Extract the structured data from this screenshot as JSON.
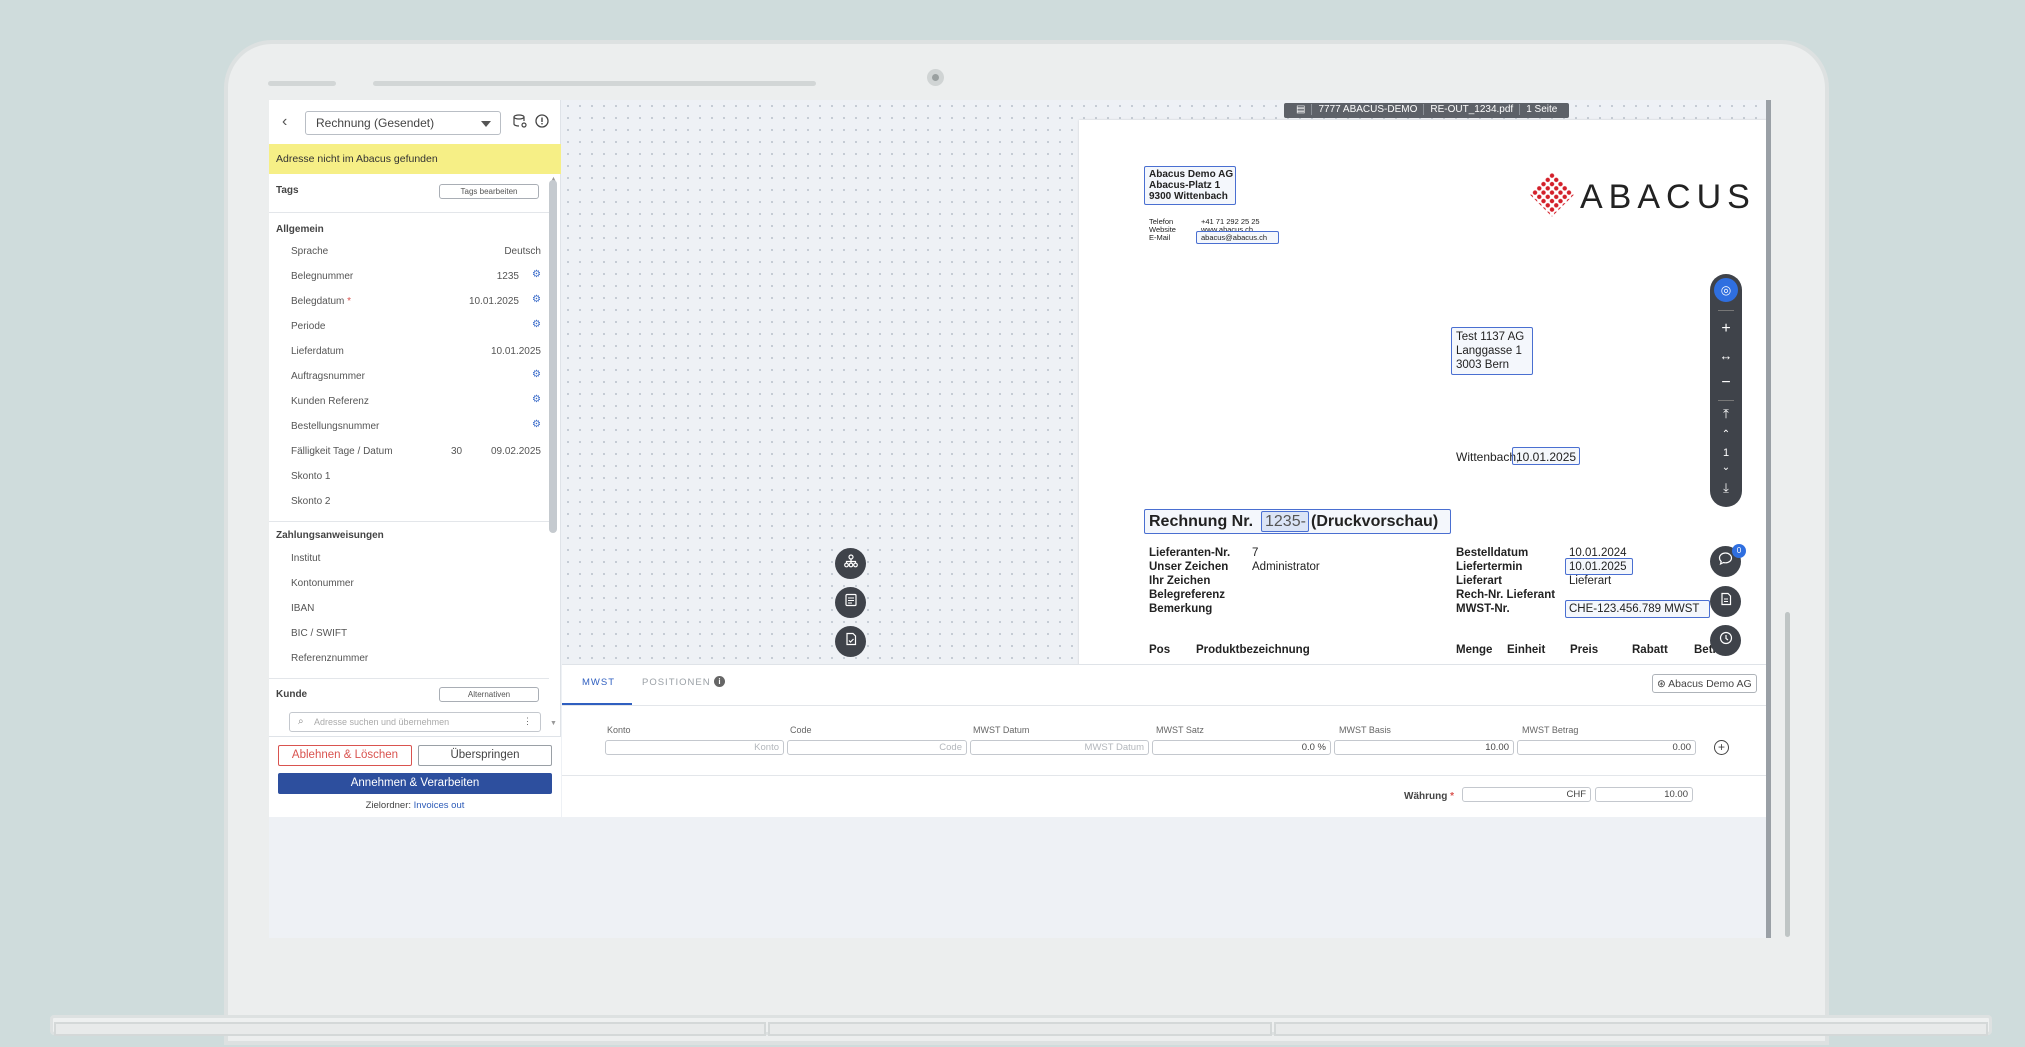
{
  "left_panel": {
    "doc_type_select": "Rechnung (Gesendet)",
    "warning": "Adresse nicht im Abacus gefunden",
    "tags": {
      "title": "Tags",
      "edit_button": "Tags bearbeiten"
    },
    "general": {
      "title": "Allgemein",
      "fields": [
        {
          "label": "Sprache",
          "value": "Deutsch"
        },
        {
          "label": "Belegnummer",
          "value": "1235"
        },
        {
          "label": "Belegdatum",
          "required": "*",
          "value": "10.01.2025"
        },
        {
          "label": "Periode",
          "value": ""
        },
        {
          "label": "Lieferdatum",
          "value": "10.01.2025"
        },
        {
          "label": "Auftragsnummer",
          "value": ""
        },
        {
          "label": "Kunden Referenz",
          "value": ""
        },
        {
          "label": "Bestellungsnummer",
          "value": ""
        },
        {
          "label": "Fälligkeit Tage / Datum",
          "days": "30",
          "value": "09.02.2025"
        },
        {
          "label": "Skonto 1",
          "value": ""
        },
        {
          "label": "Skonto 2",
          "value": ""
        }
      ]
    },
    "payment": {
      "title": "Zahlungsanweisungen",
      "fields": [
        "Institut",
        "Kontonummer",
        "IBAN",
        "BIC / SWIFT",
        "Referenznummer"
      ]
    },
    "customer": {
      "title": "Kunde",
      "alt_button": "Alternativen",
      "search_placeholder": "Adresse suchen und übernehmen"
    },
    "buttons": {
      "reject": "Ablehnen & Löschen",
      "skip": "Überspringen",
      "accept": "Annehmen & Verarbeiten"
    },
    "target_folder": {
      "label": "Zielordner:",
      "link": "Invoices out"
    }
  },
  "viewer": {
    "doc_info": [
      "7777 ABACUS-DEMO",
      "RE-OUT_1234.pdf",
      "1 Seite"
    ],
    "page_number": "1",
    "comments_badge": "0",
    "document": {
      "sender": [
        "Abacus Demo AG",
        "Abacus-Platz 1",
        "9300 Wittenbach"
      ],
      "contact_labels": [
        "Telefon",
        "Website",
        "E-Mail"
      ],
      "contact_values": [
        "+41 71 292 25 25",
        "www.abacus.ch",
        "abacus@abacus.ch"
      ],
      "logo_text": "ABACUS",
      "recipient": [
        "Test 1137 AG",
        "Langgasse 1",
        "3003 Bern"
      ],
      "place": "Wittenbach,",
      "date": "10.01.2025",
      "invoice_title_prefix": "Rechnung Nr.",
      "invoice_number": "1235-",
      "invoice_title_suffix": "(Druckvorschau)",
      "left_labels": [
        "Lieferanten-Nr.",
        "Unser Zeichen",
        "Ihr Zeichen",
        "Belegreferenz",
        "Bemerkung"
      ],
      "left_values": [
        "7",
        "Administrator"
      ],
      "right_labels": [
        "Bestelldatum",
        "Liefertermin",
        "Lieferart",
        "Rech-Nr. Lieferant",
        "MWST-Nr."
      ],
      "right_values": {
        "order_date": "10.01.2024",
        "delivery_date": "10.01.2025",
        "delivery_type": "Lieferart",
        "vat": "CHE-123.456.789 MWST"
      },
      "table_headers": [
        "Pos",
        "Produktbezeichnung",
        "Menge",
        "Einheit",
        "Preis",
        "Rabatt",
        "Betrag"
      ]
    }
  },
  "bottom_panel": {
    "tabs": [
      "MWST",
      "POSITIONEN"
    ],
    "company_chip": "Abacus Demo AG",
    "columns": [
      "Konto",
      "Code",
      "MWST Datum",
      "MWST Satz",
      "MWST Basis",
      "MWST Betrag"
    ],
    "row": {
      "konto_placeholder": "Konto",
      "code_placeholder": "Code",
      "date_placeholder": "MWST Datum",
      "rate": "0.0 %",
      "basis": "10.00",
      "amount": "0.00"
    },
    "currency": {
      "label": "Währung",
      "required": "*",
      "code": "CHF",
      "total": "10.00"
    }
  }
}
